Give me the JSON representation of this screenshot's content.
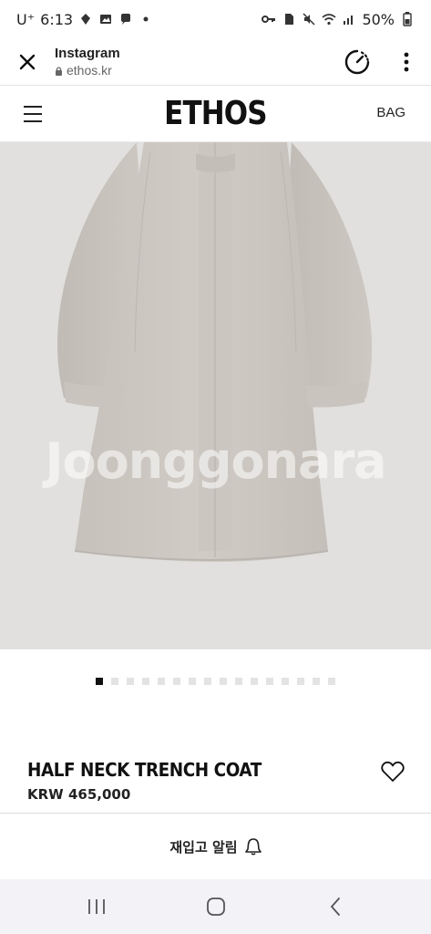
{
  "status": {
    "carrier": "U⁺",
    "time": "6:13",
    "battery": "50%",
    "left_icons": [
      "maps-icon",
      "gallery-icon",
      "chat-icon",
      "dot-icon"
    ],
    "right_icons": [
      "key-icon",
      "sim-icon",
      "mute-icon",
      "wifi-icon",
      "signal-icon",
      "battery-icon"
    ]
  },
  "browser": {
    "title": "Instagram",
    "url": "ethos.kr"
  },
  "header": {
    "logo": "ETHOS",
    "bag_label": "BAG"
  },
  "image": {
    "watermark": "Joonggonara"
  },
  "carousel": {
    "total": 16,
    "active_index": 0
  },
  "product": {
    "name": "HALF NECK TRENCH COAT",
    "price": "KRW 465,000"
  },
  "actions": {
    "restock_label": "재입고 알림"
  },
  "colors": {
    "image_bg": "#e2e0de",
    "coat": "#ccc7c1",
    "nav_bg": "#f2f2f7"
  }
}
